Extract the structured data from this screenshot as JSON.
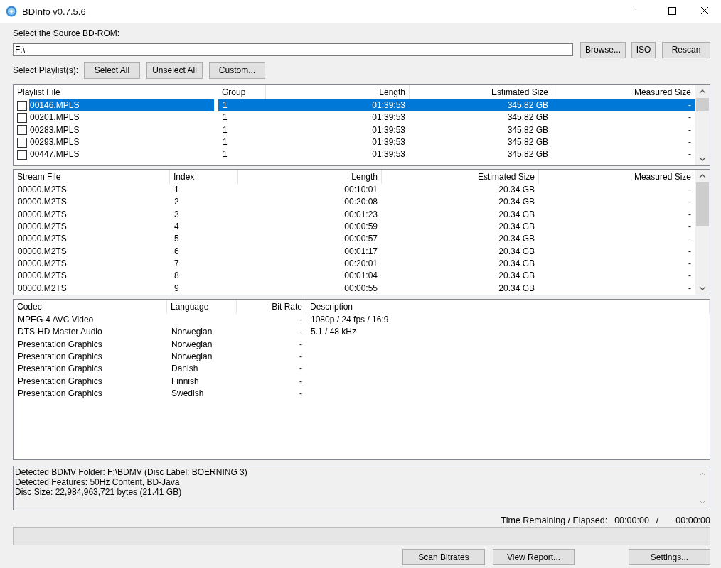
{
  "window": {
    "title": "BDInfo v0.7.5.6"
  },
  "source": {
    "label": "Select the Source BD-ROM:",
    "value": "F:\\",
    "buttons": [
      "Browse...",
      "ISO",
      "Rescan"
    ]
  },
  "playlist_select": {
    "label": "Select Playlist(s):",
    "buttons": [
      "Select All",
      "Unselect All",
      "Custom..."
    ]
  },
  "playlists": {
    "columns": [
      "Playlist File",
      "Group",
      "Length",
      "Estimated Size",
      "Measured Size"
    ],
    "rows": [
      {
        "file": "00146.MPLS",
        "group": "1",
        "length": "01:39:53",
        "estimated": "345.82 GB",
        "measured": "-",
        "checked": false,
        "selected": true
      },
      {
        "file": "00201.MPLS",
        "group": "1",
        "length": "01:39:53",
        "estimated": "345.82 GB",
        "measured": "-",
        "checked": false,
        "selected": false
      },
      {
        "file": "00283.MPLS",
        "group": "1",
        "length": "01:39:53",
        "estimated": "345.82 GB",
        "measured": "-",
        "checked": false,
        "selected": false
      },
      {
        "file": "00293.MPLS",
        "group": "1",
        "length": "01:39:53",
        "estimated": "345.82 GB",
        "measured": "-",
        "checked": false,
        "selected": false
      },
      {
        "file": "00447.MPLS",
        "group": "1",
        "length": "01:39:53",
        "estimated": "345.82 GB",
        "measured": "-",
        "checked": false,
        "selected": false
      }
    ]
  },
  "streams": {
    "columns": [
      "Stream File",
      "Index",
      "Length",
      "Estimated Size",
      "Measured Size"
    ],
    "rows": [
      [
        "00000.M2TS",
        "1",
        "00:10:01",
        "20.34 GB",
        "-"
      ],
      [
        "00000.M2TS",
        "2",
        "00:20:08",
        "20.34 GB",
        "-"
      ],
      [
        "00000.M2TS",
        "3",
        "00:01:23",
        "20.34 GB",
        "-"
      ],
      [
        "00000.M2TS",
        "4",
        "00:00:59",
        "20.34 GB",
        "-"
      ],
      [
        "00000.M2TS",
        "5",
        "00:00:57",
        "20.34 GB",
        "-"
      ],
      [
        "00000.M2TS",
        "6",
        "00:01:17",
        "20.34 GB",
        "-"
      ],
      [
        "00000.M2TS",
        "7",
        "00:20:01",
        "20.34 GB",
        "-"
      ],
      [
        "00000.M2TS",
        "8",
        "00:01:04",
        "20.34 GB",
        "-"
      ],
      [
        "00000.M2TS",
        "9",
        "00:00:55",
        "20.34 GB",
        "-"
      ]
    ]
  },
  "codecs": {
    "columns": [
      "Codec",
      "Language",
      "Bit Rate",
      "Description"
    ],
    "rows": [
      [
        "MPEG-4 AVC Video",
        "",
        "-",
        "1080p / 24 fps / 16:9"
      ],
      [
        "DTS-HD Master Audio",
        "Norwegian",
        "-",
        "5.1 / 48 kHz"
      ],
      [
        "Presentation Graphics",
        "Norwegian",
        "-",
        ""
      ],
      [
        "Presentation Graphics",
        "Norwegian",
        "-",
        ""
      ],
      [
        "Presentation Graphics",
        "Danish",
        "-",
        ""
      ],
      [
        "Presentation Graphics",
        "Finnish",
        "-",
        ""
      ],
      [
        "Presentation Graphics",
        "Swedish",
        "-",
        ""
      ]
    ]
  },
  "info": [
    "Detected BDMV Folder: F:\\BDMV (Disc Label: BOERNING 3)",
    "Detected Features: 50Hz Content, BD-Java",
    "Disc Size: 22,984,963,721 bytes (21.41 GB)"
  ],
  "time": {
    "label": "Time Remaining / Elapsed:",
    "remaining": "00:00:00",
    "separator": "/",
    "elapsed": "00:00:00"
  },
  "progress": {
    "level": 0
  },
  "buttons": [
    "Scan Bitrates",
    "View Report...",
    "Settings..."
  ]
}
